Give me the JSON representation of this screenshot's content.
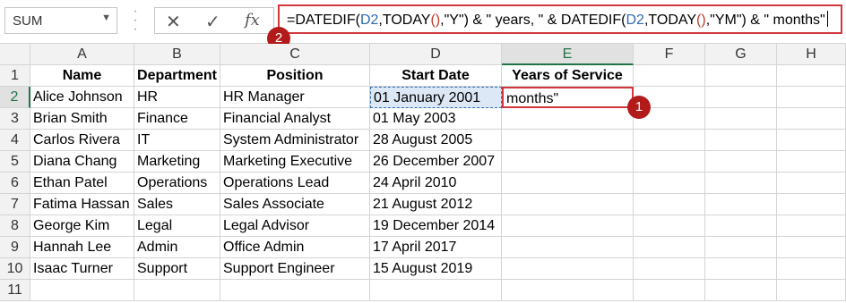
{
  "name_box": {
    "value": "SUM"
  },
  "formula_bar": {
    "cancel_icon": "✕",
    "enter_icon": "✓",
    "fx_label": "fx",
    "segments": [
      {
        "text": "=DATEDIF(",
        "kind": "plain"
      },
      {
        "text": "D2",
        "kind": "ref"
      },
      {
        "text": ",TODAY",
        "kind": "plain"
      },
      {
        "text": "()",
        "kind": "paren"
      },
      {
        "text": ",\"Y\") & \" years, \" & DATEDIF(",
        "kind": "plain"
      },
      {
        "text": "D2",
        "kind": "ref"
      },
      {
        "text": ",TODAY",
        "kind": "plain"
      },
      {
        "text": "()",
        "kind": "paren"
      },
      {
        "text": ",\"YM\") & \" months\"",
        "kind": "plain"
      }
    ]
  },
  "callouts": {
    "cell_marker": "1",
    "formula_marker": "2"
  },
  "columns": [
    "A",
    "B",
    "C",
    "D",
    "E",
    "F",
    "G",
    "H"
  ],
  "rows": [
    "1",
    "2",
    "3",
    "4",
    "5",
    "6",
    "7",
    "8",
    "9",
    "10",
    "11"
  ],
  "headers": [
    "Name",
    "Department",
    "Position",
    "Start Date",
    "Years of Service"
  ],
  "data_rows": [
    [
      "Alice Johnson",
      "HR",
      "HR Manager",
      "01 January 2001",
      "months\""
    ],
    [
      "Brian Smith",
      "Finance",
      "Financial Analyst",
      "01 May 2003",
      ""
    ],
    [
      "Carlos Rivera",
      "IT",
      "System Administrator",
      "28 August 2005",
      ""
    ],
    [
      "Diana Chang",
      "Marketing",
      "Marketing Executive",
      "26 December 2007",
      ""
    ],
    [
      "Ethan Patel",
      "Operations",
      "Operations Lead",
      "24 April 2010",
      ""
    ],
    [
      "Fatima Hassan",
      "Sales",
      "Sales Associate",
      "21 August 2012",
      ""
    ],
    [
      "George Kim",
      "Legal",
      "Legal Advisor",
      "19 December 2014",
      ""
    ],
    [
      "Hannah Lee",
      "Admin",
      "Office Admin",
      "17 April 2017",
      ""
    ],
    [
      "Isaac Turner",
      "Support",
      "Support Engineer",
      "15 August 2019",
      ""
    ]
  ],
  "active_cell": "E2",
  "colors": {
    "accent_green": "#217346",
    "callout_red": "#b31b1b",
    "ref_blue": "#2f6bb5"
  }
}
